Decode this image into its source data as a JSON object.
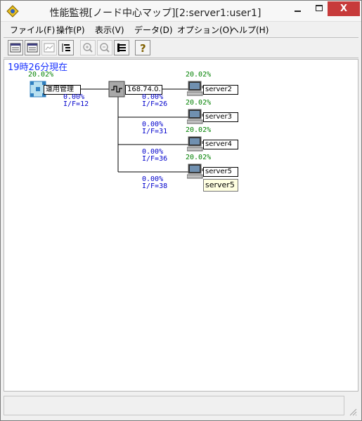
{
  "window": {
    "title": "性能監視[ノード中心マップ][2:server1:user1]",
    "minimize_label": "—",
    "maximize_label": "☐",
    "close_label": "X"
  },
  "menu": {
    "items": [
      {
        "label": "ファイル(F)"
      },
      {
        "label": "操作(P)"
      },
      {
        "label": "表示(V)"
      },
      {
        "label": "データ(D)"
      },
      {
        "label": "オプション(O)"
      },
      {
        "label": "ヘルプ(H)"
      }
    ]
  },
  "toolbar": {
    "buttons": [
      {
        "icon": "window-list-icon",
        "enabled": true
      },
      {
        "icon": "window-list-icon",
        "enabled": true
      },
      {
        "icon": "graph-window-icon",
        "enabled": false
      },
      {
        "icon": "tree-sort-icon",
        "enabled": true
      },
      {
        "icon": "zoom-in-icon",
        "enabled": false
      },
      {
        "icon": "zoom-out-icon",
        "enabled": false
      },
      {
        "icon": "hierarchy-icon",
        "enabled": true
      },
      {
        "icon": "help-icon",
        "enabled": true
      }
    ]
  },
  "map": {
    "clock": "19時26分現在",
    "center": {
      "label": "運用管理",
      "load": "20.02%",
      "link_load": "0.00%",
      "interface": "I/F=12"
    },
    "router": {
      "label": "168.74.0."
    },
    "servers": [
      {
        "label": "server2",
        "load": "20.02%",
        "link_load": "0.00%",
        "interface": "I/F=26"
      },
      {
        "label": "server3",
        "load": "20.02%",
        "link_load": "0.00%",
        "interface": "I/F=31"
      },
      {
        "label": "server4",
        "load": "20.02%",
        "link_load": "0.00%",
        "interface": "I/F=36"
      },
      {
        "label": "server5",
        "load": "20.02%",
        "link_load": "0.00%",
        "interface": "I/F=38"
      }
    ],
    "tooltip": "server5"
  },
  "colors": {
    "clock": "#1a33ff",
    "load_text": "#008000",
    "link_text": "#0000cc",
    "close_button": "#c73b3b",
    "tooltip_bg": "#ffffe1"
  }
}
